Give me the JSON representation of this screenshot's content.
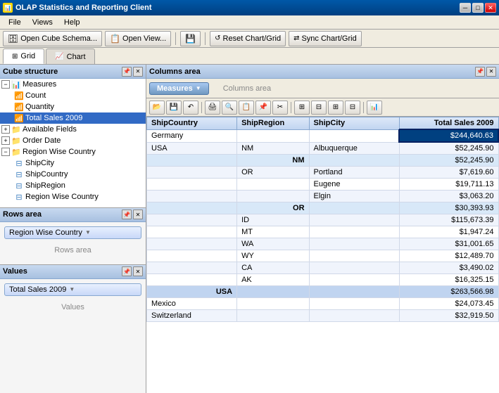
{
  "titleBar": {
    "title": "OLAP Statistics and Reporting Client",
    "minimizeLabel": "─",
    "maximizeLabel": "□",
    "closeLabel": "✕"
  },
  "menuBar": {
    "items": [
      "File",
      "Views",
      "Help"
    ]
  },
  "toolbar": {
    "openCubeSchema": "Open Cube Schema...",
    "openView": "Open View...",
    "save": "💾",
    "resetChartGrid": "Reset Chart/Grid",
    "syncChartGrid": "Sync Chart/Grid"
  },
  "tabs": {
    "grid": "Grid",
    "chart": "Chart"
  },
  "leftPanel": {
    "cubeStructure": {
      "title": "Cube structure",
      "items": [
        {
          "label": "Measures",
          "type": "folder",
          "level": 0,
          "expanded": true
        },
        {
          "label": "Count",
          "type": "measure",
          "level": 1
        },
        {
          "label": "Quantity",
          "type": "measure",
          "level": 1
        },
        {
          "label": "Total Sales 2009",
          "type": "measure",
          "level": 1,
          "selected": true
        },
        {
          "label": "Available Fields",
          "type": "folder",
          "level": 0,
          "expanded": false
        },
        {
          "label": "Order Date",
          "type": "folder",
          "level": 0,
          "expanded": false
        },
        {
          "label": "Region Wise Country",
          "type": "folder",
          "level": 0,
          "expanded": true
        },
        {
          "label": "ShipCity",
          "type": "field",
          "level": 1
        },
        {
          "label": "ShipCountry",
          "type": "field",
          "level": 1
        },
        {
          "label": "ShipRegion",
          "type": "field",
          "level": 1
        },
        {
          "label": "Region Wise Country",
          "type": "field",
          "level": 1
        }
      ]
    },
    "rowsArea": {
      "title": "Rows area",
      "chip": "Region Wise Country",
      "placeholder": "Rows area"
    },
    "valuesArea": {
      "title": "Values",
      "chip": "Total Sales 2009",
      "placeholder": "Values"
    }
  },
  "rightPanel": {
    "columnsArea": {
      "title": "Columns area",
      "placeholder": "Columns area"
    },
    "measuresTab": "Measures",
    "gridColumns": {
      "measures": "Measures",
      "totalSales": "Total Sales 2009",
      "shipCountry": "ShipCountry",
      "shipRegion": "ShipRegion",
      "shipCity": "ShipCity"
    },
    "tableData": [
      {
        "country": "Germany",
        "region": "",
        "city": "",
        "value": "$244,640.63",
        "highlighted": true
      },
      {
        "country": "USA",
        "region": "NM",
        "city": "Albuquerque",
        "value": "$52,245.90",
        "highlighted": false
      },
      {
        "country": "",
        "region": "NM",
        "city": "",
        "value": "$52,245.90",
        "subtotal": true
      },
      {
        "country": "",
        "region": "OR",
        "city": "Portland",
        "value": "$7,619.60",
        "highlighted": false
      },
      {
        "country": "",
        "region": "",
        "city": "Eugene",
        "value": "$19,711.13",
        "highlighted": false
      },
      {
        "country": "",
        "region": "",
        "city": "Elgin",
        "value": "$3,063.20",
        "highlighted": false
      },
      {
        "country": "",
        "region": "OR",
        "city": "",
        "value": "$30,393.93",
        "subtotal": true
      },
      {
        "country": "",
        "region": "ID",
        "city": "",
        "value": "$115,673.39",
        "highlighted": false
      },
      {
        "country": "",
        "region": "MT",
        "city": "",
        "value": "$1,947.24",
        "highlighted": false
      },
      {
        "country": "",
        "region": "WA",
        "city": "",
        "value": "$31,001.65",
        "highlighted": false
      },
      {
        "country": "",
        "region": "WY",
        "city": "",
        "value": "$12,489.70",
        "highlighted": false
      },
      {
        "country": "",
        "region": "CA",
        "city": "",
        "value": "$3,490.02",
        "highlighted": false
      },
      {
        "country": "",
        "region": "AK",
        "city": "",
        "value": "$16,325.15",
        "highlighted": false
      },
      {
        "country": "USA",
        "region": "",
        "city": "",
        "value": "$263,566.98",
        "grandtotal": true
      },
      {
        "country": "Mexico",
        "region": "",
        "city": "",
        "value": "$24,073.45",
        "highlighted": false
      },
      {
        "country": "Switzerland",
        "region": "",
        "city": "",
        "value": "$32,919.50",
        "highlighted": false
      }
    ]
  }
}
